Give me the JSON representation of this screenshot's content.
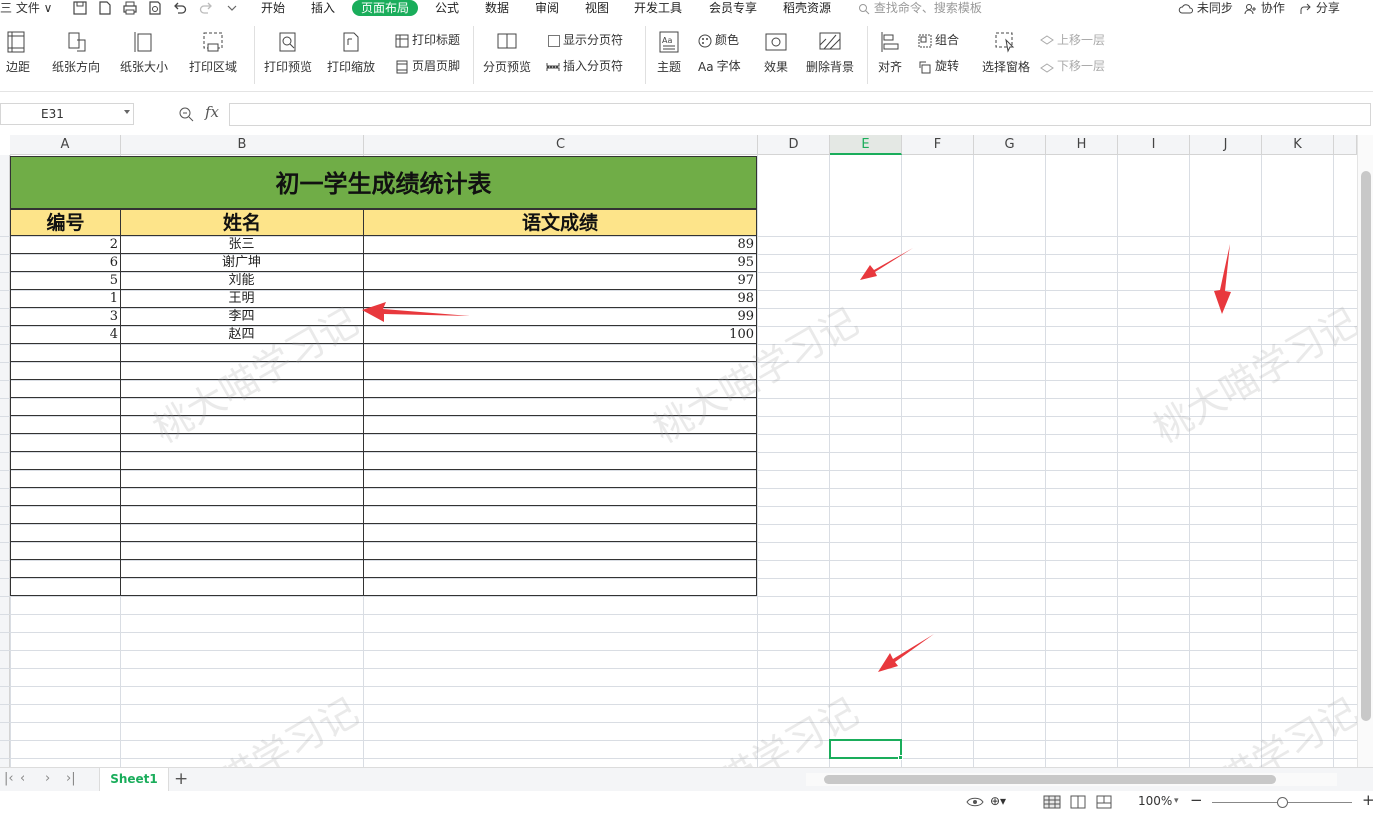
{
  "menubar": {
    "file_label": "三 文件 ∨",
    "tabs": [
      "开始",
      "插入",
      "页面布局",
      "公式",
      "数据",
      "审阅",
      "视图",
      "开发工具",
      "会员专享",
      "稻壳资源"
    ],
    "active_tab": "页面布局",
    "search_placeholder": "查找命令、搜索模板",
    "sync_label": "未同步",
    "collab_label": "协作",
    "share_label": "分享"
  },
  "ribbon": {
    "margins": "边距",
    "orientation": "纸张方向",
    "size": "纸张大小",
    "print_area": "打印区域",
    "print_preview": "打印预览",
    "print_scale": "打印缩放",
    "print_titles": "打印标题",
    "header_footer": "页眉页脚",
    "page_break_preview": "分页预览",
    "show_page_breaks": "显示分页符",
    "insert_page_break": "插入分页符",
    "theme": "主题",
    "colors": "颜色",
    "fonts": "字体",
    "effects": "效果",
    "delete_background": "删除背景",
    "align": "对齐",
    "group": "组合",
    "rotate": "旋转",
    "selection_pane": "选择窗格",
    "bring_forward": "上移一层",
    "send_backward": "下移一层"
  },
  "formula_bar": {
    "name_box": "E31",
    "fx": "fx",
    "formula": ""
  },
  "columns": [
    "A",
    "B",
    "C",
    "D",
    "E",
    "F",
    "G",
    "H",
    "I",
    "J",
    "K"
  ],
  "selected_column": "E",
  "sheet": {
    "title": "初一学生成绩统计表",
    "headers": [
      "编号",
      "姓名",
      "语文成绩"
    ],
    "rows": [
      {
        "id": "2",
        "name": "张三",
        "score": "89"
      },
      {
        "id": "6",
        "name": "谢广坤",
        "score": "95"
      },
      {
        "id": "5",
        "name": "刘能",
        "score": "97"
      },
      {
        "id": "1",
        "name": "王明",
        "score": "98"
      },
      {
        "id": "3",
        "name": "李四",
        "score": "99"
      },
      {
        "id": "4",
        "name": "赵四",
        "score": "100"
      }
    ]
  },
  "watermark": "桃大喵学习记",
  "sheet_tabs": {
    "active": "Sheet1",
    "add": "+"
  },
  "status": {
    "zoom": "100%"
  },
  "colors": {
    "accent": "#1aad5b",
    "title_fill": "#70ad47",
    "header_fill": "#fde48a",
    "arrow": "#e8383d"
  }
}
